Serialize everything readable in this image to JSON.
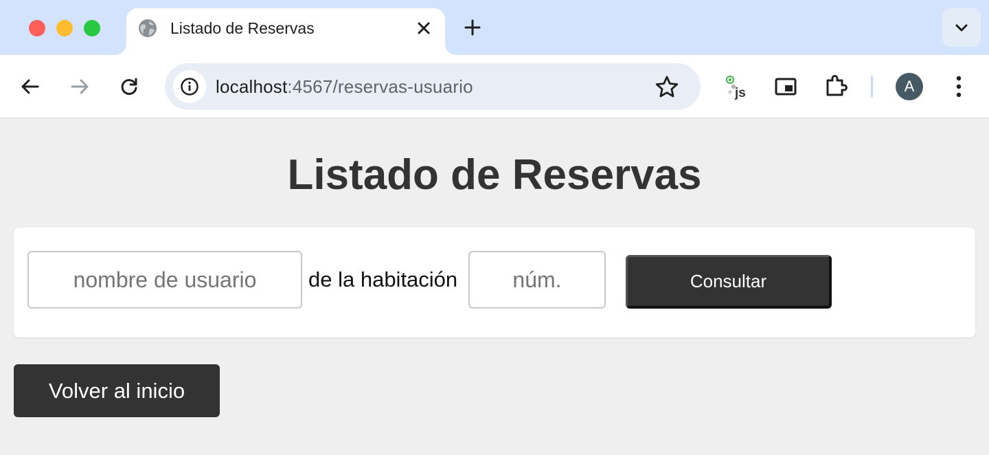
{
  "browser": {
    "tab": {
      "title": "Listado de Reservas",
      "icon": "globe-icon"
    },
    "new_tab_icon": "plus-icon",
    "tab_search_icon": "chevron-down-icon",
    "url": {
      "host": "localhost",
      "rest": ":4567/reservas-usuario"
    },
    "profile_initial": "A",
    "colors": {
      "tabstrip": "#d3e3fd",
      "omnibox": "#e9eef6",
      "avatar": "#455a64"
    }
  },
  "page": {
    "heading": "Listado de Reservas",
    "form": {
      "username_placeholder": "nombre de usuario",
      "room_label": "de la habitación",
      "room_placeholder": "núm.",
      "submit_label": "Consultar"
    },
    "back_button_label": "Volver al inicio",
    "colors": {
      "background": "#efefef",
      "button": "#333333",
      "heading": "#333333"
    }
  }
}
